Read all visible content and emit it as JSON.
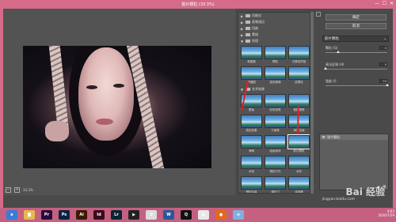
{
  "window": {
    "title": "胶片颗粒 (33.3%)",
    "minimize": "—",
    "maximize": "☐",
    "close": "✕"
  },
  "preview": {
    "zoom": "33.3%",
    "minus": "−",
    "plus": "+"
  },
  "gallery": {
    "folders": [
      {
        "label": "风格化",
        "expanded": false
      },
      {
        "label": "画笔描边",
        "expanded": false
      },
      {
        "label": "扭曲",
        "expanded": false
      },
      {
        "label": "素描",
        "expanded": false
      },
      {
        "label": "纹理",
        "expanded": true
      }
    ],
    "texture_thumbs": [
      "龟裂缝",
      "颗粒",
      "马赛克拼贴",
      "拼缀图",
      "染色玻璃",
      "纹理化"
    ],
    "art_folder": "艺术效果",
    "art_thumbs": [
      "壁画",
      "彩色铅笔",
      "粗糙蜡笔",
      "底纹效果",
      "干画笔",
      "海报边缘",
      "海绵",
      "绘画涂抹",
      "胶片颗粒",
      "木刻",
      "霓虹灯光",
      "水彩",
      "塑料包装",
      "调色刀",
      "涂抹棒"
    ],
    "selected": "胶片颗粒"
  },
  "panel": {
    "ok_label": "确定",
    "cancel_label": "取消",
    "filter_name": "胶片颗粒",
    "params": [
      {
        "label": "颗粒 (G)",
        "value": "4",
        "level": 0.2
      },
      {
        "label": "高光区域 (H)",
        "value": "0",
        "level": 0.0
      },
      {
        "label": "强度 (I)",
        "value": "10",
        "level": 1.0
      }
    ],
    "layer_name": "胶片颗粒"
  },
  "taskbar": {
    "icons": [
      {
        "name": "browser-icon",
        "color": "#3a7bd5",
        "glyph": "e"
      },
      {
        "name": "folder-icon",
        "color": "#e8b84a",
        "glyph": "▇"
      },
      {
        "name": "premiere-icon",
        "color": "#2a0a3a",
        "glyph": "Pr"
      },
      {
        "name": "photoshop-icon",
        "color": "#0b2340",
        "glyph": "Ps"
      },
      {
        "name": "illustrator-icon",
        "color": "#3a1a00",
        "glyph": "Ai"
      },
      {
        "name": "indesign-icon",
        "color": "#3a0a1e",
        "glyph": "Id"
      },
      {
        "name": "lightroom-icon",
        "color": "#0c2433",
        "glyph": "Lr"
      },
      {
        "name": "media-icon",
        "color": "#222222",
        "glyph": "▶"
      },
      {
        "name": "pinwheel-icon",
        "color": "#dddddd",
        "glyph": "✿"
      },
      {
        "name": "word-icon",
        "color": "#2b579a",
        "glyph": "W"
      },
      {
        "name": "qq-icon",
        "color": "#111111",
        "glyph": "Q"
      },
      {
        "name": "chrome-icon",
        "color": "#e8e8e8",
        "glyph": "◉"
      },
      {
        "name": "firefox-icon",
        "color": "#e06a1e",
        "glyph": "●"
      },
      {
        "name": "notes-icon",
        "color": "#7fb0e0",
        "glyph": "≡"
      }
    ],
    "time": "9:03",
    "date": "2020/7/29"
  },
  "watermark": {
    "text": "Bai 经验",
    "url": "jingyan.baidu.com"
  },
  "colors": {
    "frame": "#d56b89",
    "dialog_bg": "#4a4a4a",
    "arrow": "#e02020"
  }
}
